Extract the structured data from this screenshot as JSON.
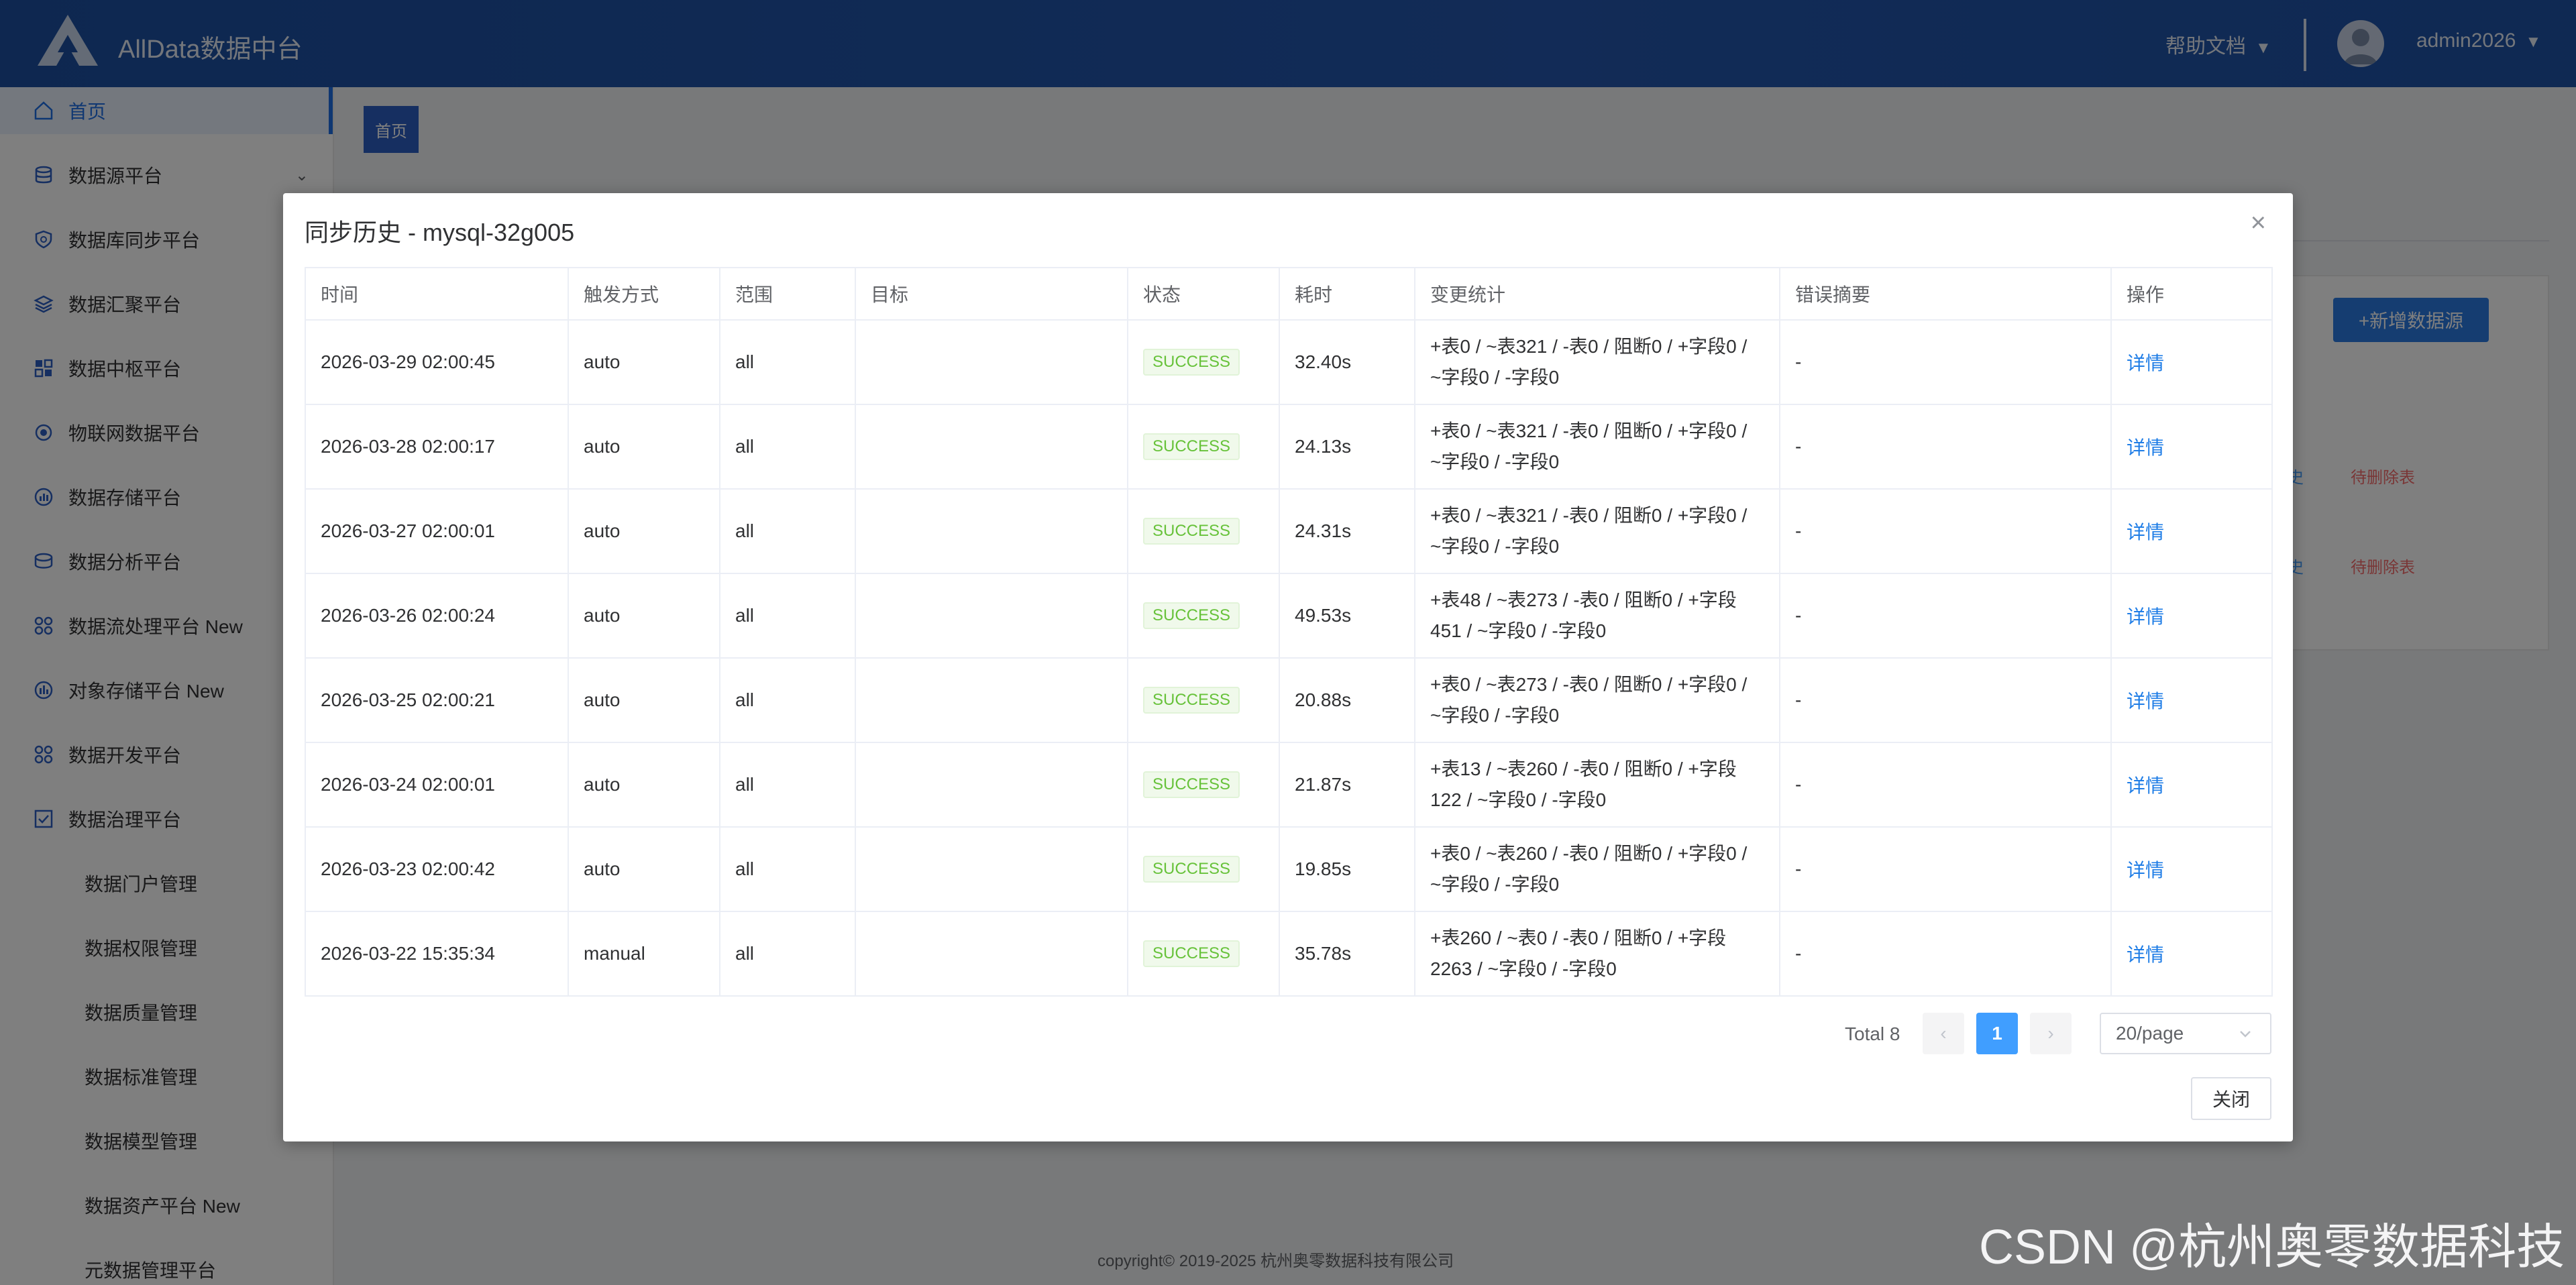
{
  "header": {
    "brand": "AllData数据中台",
    "help": "帮助文档",
    "user": "admin2026"
  },
  "sidebar": {
    "items": [
      {
        "label": "首页",
        "icon": "home-icon",
        "active": true
      },
      {
        "label": "数据源平台",
        "icon": "database-icon",
        "expand": true
      },
      {
        "label": "数据库同步平台",
        "icon": "shield-icon"
      },
      {
        "label": "数据汇聚平台",
        "icon": "layers-icon"
      },
      {
        "label": "数据中枢平台",
        "icon": "grid-icon"
      },
      {
        "label": "物联网数据平台",
        "icon": "link-icon"
      },
      {
        "label": "数据存储平台",
        "icon": "storage-icon"
      },
      {
        "label": "数据分析平台",
        "icon": "analysis-icon"
      },
      {
        "label": "数据流处理平台 New",
        "icon": "flow-icon"
      },
      {
        "label": "对象存储平台 New",
        "icon": "bars-icon"
      },
      {
        "label": "数据开发平台",
        "icon": "apps-icon"
      },
      {
        "label": "数据治理平台",
        "icon": "check-icon"
      }
    ],
    "sub_items": [
      "数据门户管理",
      "数据权限管理",
      "数据质量管理",
      "数据标准管理",
      "数据模型管理",
      "数据资产平台 New",
      "元数据管理平台"
    ]
  },
  "main": {
    "tag": "首页",
    "add_button": "+新增数据源",
    "row_link": "史",
    "row_delete": "待删除表",
    "copyright": "copyright© 2019-2025 杭州奥零数据科技有限公司"
  },
  "dialog": {
    "title": "同步历史 - mysql-32g005",
    "close_icon": "close-icon",
    "columns": [
      "时间",
      "触发方式",
      "范围",
      "目标",
      "状态",
      "耗时",
      "变更统计",
      "错误摘要",
      "操作"
    ],
    "rows": [
      {
        "time": "2026-03-29 02:00:45",
        "trigger": "auto",
        "scope": "all",
        "target": "",
        "status": "SUCCESS",
        "duration": "32.40s",
        "stats1": "+表0 / ~表321 / -表0 / 阻断0 / +字段0 /",
        "stats2": "~字段0 / -字段0",
        "error": "-",
        "action": "详情"
      },
      {
        "time": "2026-03-28 02:00:17",
        "trigger": "auto",
        "scope": "all",
        "target": "",
        "status": "SUCCESS",
        "duration": "24.13s",
        "stats1": "+表0 / ~表321 / -表0 / 阻断0 / +字段0 /",
        "stats2": "~字段0 / -字段0",
        "error": "-",
        "action": "详情"
      },
      {
        "time": "2026-03-27 02:00:01",
        "trigger": "auto",
        "scope": "all",
        "target": "",
        "status": "SUCCESS",
        "duration": "24.31s",
        "stats1": "+表0 / ~表321 / -表0 / 阻断0 / +字段0 /",
        "stats2": "~字段0 / -字段0",
        "error": "-",
        "action": "详情"
      },
      {
        "time": "2026-03-26 02:00:24",
        "trigger": "auto",
        "scope": "all",
        "target": "",
        "status": "SUCCESS",
        "duration": "49.53s",
        "stats1": "+表48 / ~表273 / -表0 / 阻断0 / +字段",
        "stats2": "451 / ~字段0 / -字段0",
        "error": "-",
        "action": "详情"
      },
      {
        "time": "2026-03-25 02:00:21",
        "trigger": "auto",
        "scope": "all",
        "target": "",
        "status": "SUCCESS",
        "duration": "20.88s",
        "stats1": "+表0 / ~表273 / -表0 / 阻断0 / +字段0 /",
        "stats2": "~字段0 / -字段0",
        "error": "-",
        "action": "详情"
      },
      {
        "time": "2026-03-24 02:00:01",
        "trigger": "auto",
        "scope": "all",
        "target": "",
        "status": "SUCCESS",
        "duration": "21.87s",
        "stats1": "+表13 / ~表260 / -表0 / 阻断0 / +字段",
        "stats2": "122 / ~字段0 / -字段0",
        "error": "-",
        "action": "详情"
      },
      {
        "time": "2026-03-23 02:00:42",
        "trigger": "auto",
        "scope": "all",
        "target": "",
        "status": "SUCCESS",
        "duration": "19.85s",
        "stats1": "+表0 / ~表260 / -表0 / 阻断0 / +字段0 /",
        "stats2": "~字段0 / -字段0",
        "error": "-",
        "action": "详情"
      },
      {
        "time": "2026-03-22 15:35:34",
        "trigger": "manual",
        "scope": "all",
        "target": "",
        "status": "SUCCESS",
        "duration": "35.78s",
        "stats1": "+表260 / ~表0 / -表0 / 阻断0 / +字段",
        "stats2": "2263 / ~字段0 / -字段0",
        "error": "-",
        "action": "详情"
      }
    ],
    "pagination": {
      "total": "Total 8",
      "current": "1",
      "page_size": "20/page"
    },
    "close_button": "关闭"
  },
  "watermark": "CSDN @杭州奥零数据科技"
}
